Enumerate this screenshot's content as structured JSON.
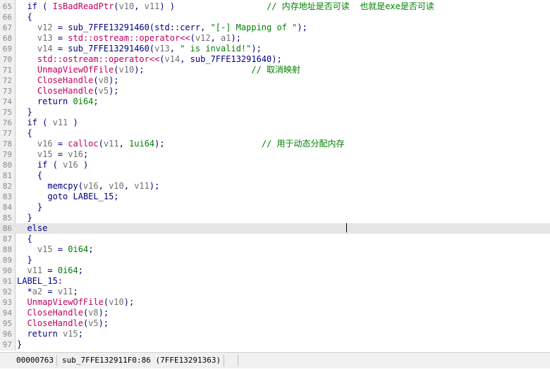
{
  "editor": {
    "lines": [
      {
        "num": "65",
        "tokens": [
          [
            "  ",
            "kw"
          ],
          [
            "if",
            "kw"
          ],
          [
            " ( ",
            "punc"
          ],
          [
            "IsBadReadPtr",
            "fn"
          ],
          [
            "(",
            "punc"
          ],
          [
            "v10",
            "var"
          ],
          [
            ", ",
            "punc"
          ],
          [
            "v11",
            "var"
          ],
          [
            ") )                  ",
            "punc"
          ],
          [
            "// 内存地址是否可读  也就是exe是否可读",
            "cmt"
          ]
        ]
      },
      {
        "num": "66",
        "tokens": [
          [
            "  {",
            "punc"
          ]
        ]
      },
      {
        "num": "67",
        "tokens": [
          [
            "    ",
            "punc"
          ],
          [
            "v12",
            "var"
          ],
          [
            " = sub_7FFE13291460(std::cerr, ",
            "id"
          ],
          [
            "\"[-] Mapping of \"",
            "str"
          ],
          [
            ");",
            "punc"
          ]
        ]
      },
      {
        "num": "68",
        "tokens": [
          [
            "    ",
            "punc"
          ],
          [
            "v13",
            "var"
          ],
          [
            " = ",
            "punc"
          ],
          [
            "std::ostream::operator<<",
            "fn"
          ],
          [
            "(",
            "punc"
          ],
          [
            "v12",
            "var"
          ],
          [
            ", ",
            "punc"
          ],
          [
            "a1",
            "var"
          ],
          [
            ");",
            "punc"
          ]
        ]
      },
      {
        "num": "69",
        "tokens": [
          [
            "    ",
            "punc"
          ],
          [
            "v14",
            "var"
          ],
          [
            " = sub_7FFE13291460(",
            "id"
          ],
          [
            "v13",
            "var"
          ],
          [
            ", ",
            "punc"
          ],
          [
            "\" is invalid!\"",
            "str"
          ],
          [
            ");",
            "punc"
          ]
        ]
      },
      {
        "num": "70",
        "tokens": [
          [
            "    ",
            "punc"
          ],
          [
            "std::ostream::operator<<",
            "fn"
          ],
          [
            "(",
            "punc"
          ],
          [
            "v14",
            "var"
          ],
          [
            ", sub_7FFE13291640);",
            "id"
          ]
        ]
      },
      {
        "num": "71",
        "tokens": [
          [
            "    ",
            "punc"
          ],
          [
            "UnmapViewOfFile",
            "fn"
          ],
          [
            "(",
            "punc"
          ],
          [
            "v10",
            "var"
          ],
          [
            ");                     ",
            "punc"
          ],
          [
            "// 取消映射",
            "cmt"
          ]
        ]
      },
      {
        "num": "72",
        "tokens": [
          [
            "    ",
            "punc"
          ],
          [
            "CloseHandle",
            "fn"
          ],
          [
            "(",
            "punc"
          ],
          [
            "v8",
            "var"
          ],
          [
            ");",
            "punc"
          ]
        ]
      },
      {
        "num": "73",
        "tokens": [
          [
            "    ",
            "punc"
          ],
          [
            "CloseHandle",
            "fn"
          ],
          [
            "(",
            "punc"
          ],
          [
            "v5",
            "var"
          ],
          [
            ");",
            "punc"
          ]
        ]
      },
      {
        "num": "74",
        "tokens": [
          [
            "    ",
            "punc"
          ],
          [
            "return",
            "kw"
          ],
          [
            " ",
            "punc"
          ],
          [
            "0i64",
            "num"
          ],
          [
            ";",
            "punc"
          ]
        ]
      },
      {
        "num": "75",
        "tokens": [
          [
            "  }",
            "punc"
          ]
        ]
      },
      {
        "num": "76",
        "tokens": [
          [
            "  ",
            "punc"
          ],
          [
            "if",
            "kw"
          ],
          [
            " ( ",
            "punc"
          ],
          [
            "v11",
            "var"
          ],
          [
            " )",
            "punc"
          ]
        ]
      },
      {
        "num": "77",
        "tokens": [
          [
            "  {",
            "punc"
          ]
        ]
      },
      {
        "num": "78",
        "tokens": [
          [
            "    ",
            "punc"
          ],
          [
            "v16",
            "var"
          ],
          [
            " = ",
            "punc"
          ],
          [
            "calloc",
            "fn"
          ],
          [
            "(",
            "punc"
          ],
          [
            "v11",
            "var"
          ],
          [
            ", ",
            "punc"
          ],
          [
            "1ui64",
            "num"
          ],
          [
            ");                   ",
            "punc"
          ],
          [
            "// 用于动态分配内存",
            "cmt"
          ]
        ]
      },
      {
        "num": "79",
        "tokens": [
          [
            "    ",
            "punc"
          ],
          [
            "v15",
            "var"
          ],
          [
            " = ",
            "punc"
          ],
          [
            "v16",
            "var"
          ],
          [
            ";",
            "punc"
          ]
        ]
      },
      {
        "num": "80",
        "tokens": [
          [
            "    ",
            "punc"
          ],
          [
            "if",
            "kw"
          ],
          [
            " ( ",
            "punc"
          ],
          [
            "v16",
            "var"
          ],
          [
            " )",
            "punc"
          ]
        ]
      },
      {
        "num": "81",
        "tokens": [
          [
            "    {",
            "punc"
          ]
        ]
      },
      {
        "num": "82",
        "tokens": [
          [
            "      memcpy(",
            "id"
          ],
          [
            "v16",
            "var"
          ],
          [
            ", ",
            "punc"
          ],
          [
            "v10",
            "var"
          ],
          [
            ", ",
            "punc"
          ],
          [
            "v11",
            "var"
          ],
          [
            ");",
            "punc"
          ]
        ]
      },
      {
        "num": "83",
        "tokens": [
          [
            "      ",
            "punc"
          ],
          [
            "goto",
            "kw"
          ],
          [
            " ",
            "punc"
          ],
          [
            "LABEL_15",
            "lab"
          ],
          [
            ";",
            "punc"
          ]
        ]
      },
      {
        "num": "84",
        "tokens": [
          [
            "    }",
            "punc"
          ]
        ]
      },
      {
        "num": "85",
        "tokens": [
          [
            "  }",
            "punc"
          ]
        ]
      },
      {
        "num": "86",
        "tokens": [
          [
            "  ",
            "punc"
          ],
          [
            "else",
            "kw"
          ]
        ],
        "highlight": true
      },
      {
        "num": "87",
        "tokens": [
          [
            "  {",
            "punc"
          ]
        ]
      },
      {
        "num": "88",
        "tokens": [
          [
            "    ",
            "punc"
          ],
          [
            "v15",
            "var"
          ],
          [
            " = ",
            "punc"
          ],
          [
            "0i64",
            "num"
          ],
          [
            ";",
            "punc"
          ]
        ]
      },
      {
        "num": "89",
        "tokens": [
          [
            "  }",
            "punc"
          ]
        ]
      },
      {
        "num": "90",
        "tokens": [
          [
            "  ",
            "punc"
          ],
          [
            "v11",
            "var"
          ],
          [
            " = ",
            "punc"
          ],
          [
            "0i64",
            "num"
          ],
          [
            ";",
            "punc"
          ]
        ]
      },
      {
        "num": "91",
        "tokens": [
          [
            "LABEL_15",
            "lab"
          ],
          [
            ":",
            "punc"
          ]
        ]
      },
      {
        "num": "92",
        "tokens": [
          [
            "  *",
            "punc"
          ],
          [
            "a2",
            "var"
          ],
          [
            " = ",
            "punc"
          ],
          [
            "v11",
            "var"
          ],
          [
            ";",
            "punc"
          ]
        ]
      },
      {
        "num": "93",
        "tokens": [
          [
            "  ",
            "punc"
          ],
          [
            "UnmapViewOfFile",
            "fn"
          ],
          [
            "(",
            "punc"
          ],
          [
            "v10",
            "var"
          ],
          [
            ");",
            "punc"
          ]
        ]
      },
      {
        "num": "94",
        "tokens": [
          [
            "  ",
            "punc"
          ],
          [
            "CloseHandle",
            "fn"
          ],
          [
            "(",
            "punc"
          ],
          [
            "v8",
            "var"
          ],
          [
            ");",
            "punc"
          ]
        ]
      },
      {
        "num": "95",
        "tokens": [
          [
            "  ",
            "punc"
          ],
          [
            "CloseHandle",
            "fn"
          ],
          [
            "(",
            "punc"
          ],
          [
            "v5",
            "var"
          ],
          [
            ");",
            "punc"
          ]
        ]
      },
      {
        "num": "96",
        "tokens": [
          [
            "  ",
            "punc"
          ],
          [
            "return",
            "kw"
          ],
          [
            " ",
            "punc"
          ],
          [
            "v15",
            "var"
          ],
          [
            ";",
            "punc"
          ]
        ]
      },
      {
        "num": "97",
        "tokens": [
          [
            "}",
            "punc"
          ]
        ]
      }
    ]
  },
  "statusbar": {
    "offset": "00000763",
    "location": "sub_7FFE132911F0:86 (7FFE13291363)"
  }
}
